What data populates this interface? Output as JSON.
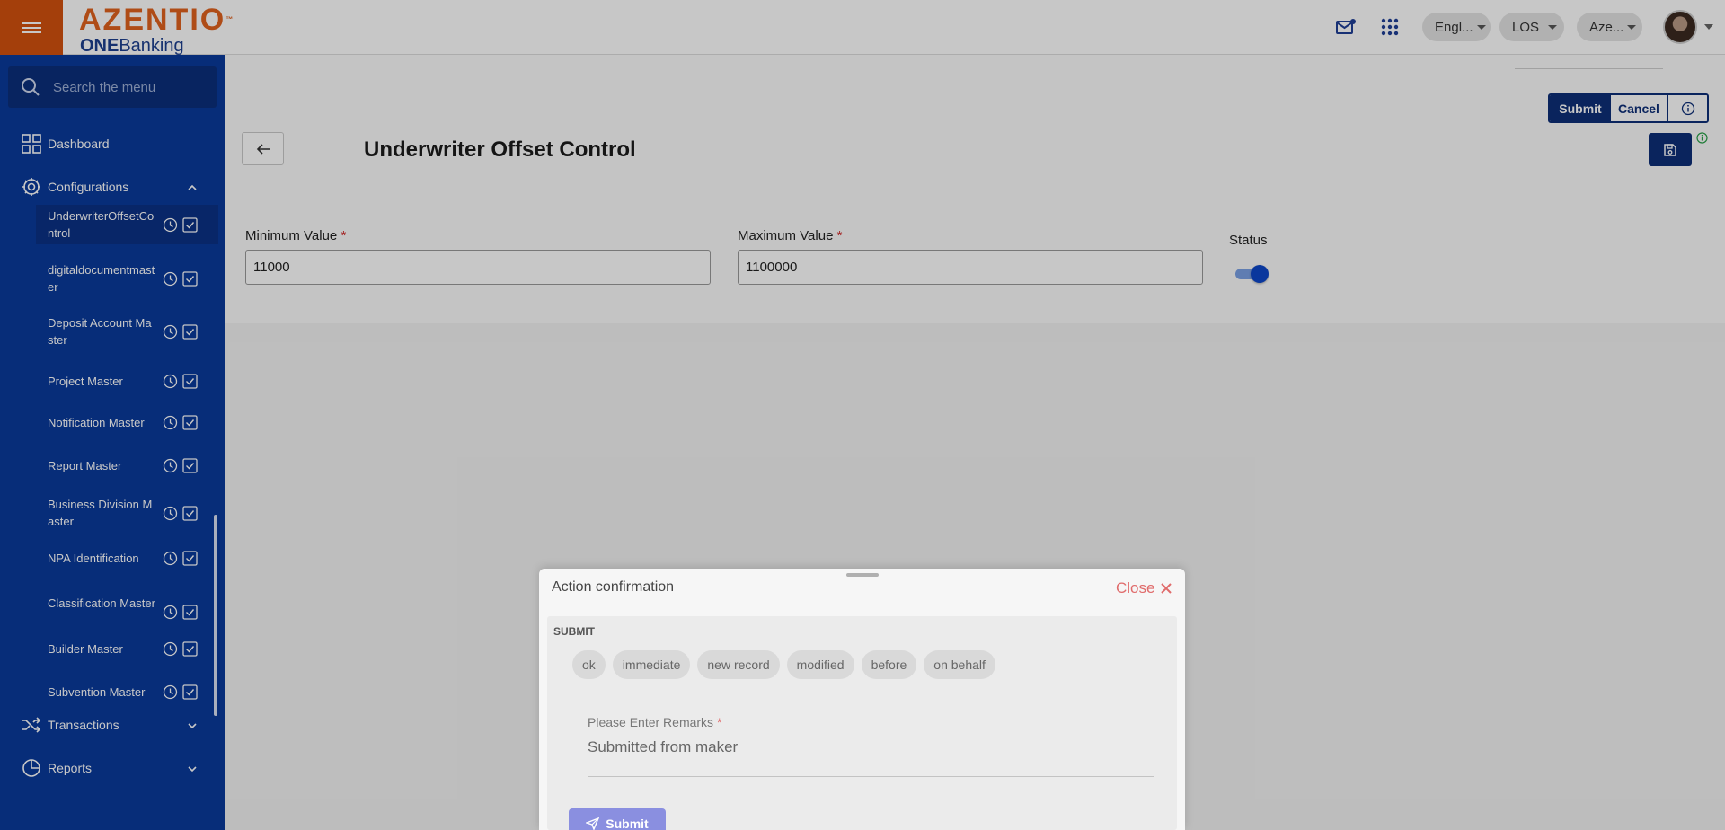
{
  "header": {
    "brand": "AZENTIO",
    "brand_mark": "™",
    "product_bold": "ONE",
    "product_rest": "Banking",
    "language_pill": "Engl...",
    "module_pill": "LOS",
    "entity_pill": "Aze..."
  },
  "sidebar": {
    "search_placeholder": "Search the menu",
    "dashboard_label": "Dashboard",
    "configurations_label": "Configurations",
    "transactions_label": "Transactions",
    "reports_label": "Reports",
    "config_items": [
      {
        "label": "UnderwriterOffsetControl"
      },
      {
        "label": "digitaldocumentmaster"
      },
      {
        "label": "Deposit Account Master"
      },
      {
        "label": "Project Master"
      },
      {
        "label": "Notification Master"
      },
      {
        "label": "Report Master"
      },
      {
        "label": "Business Division Master"
      },
      {
        "label": "NPA Identification"
      },
      {
        "label": "Classification Master"
      },
      {
        "label": "Builder Master"
      },
      {
        "label": "Subvention Master"
      }
    ]
  },
  "page": {
    "title": "Underwriter Offset Control",
    "toolbar": {
      "submit_label": "Submit",
      "cancel_label": "Cancel"
    },
    "fields": {
      "min_label": "Minimum Value",
      "min_value": "11000",
      "max_label": "Maximum Value",
      "max_value": "1100000",
      "status_label": "Status",
      "status_on": true
    },
    "required_mark": "*"
  },
  "modal": {
    "title": "Action confirmation",
    "close_label": "Close",
    "section_label": "SUBMIT",
    "chips": [
      "ok",
      "immediate",
      "new record",
      "modified",
      "before",
      "on behalf"
    ],
    "remarks_label": "Please Enter Remarks",
    "remarks_value": "Submitted from maker",
    "submit_label": "Submit"
  },
  "colors": {
    "brand_orange": "#d2510f",
    "sidebar_blue": "#0a3a9c",
    "primary_navy": "#0d2f78",
    "close_red": "#e06b6b"
  }
}
